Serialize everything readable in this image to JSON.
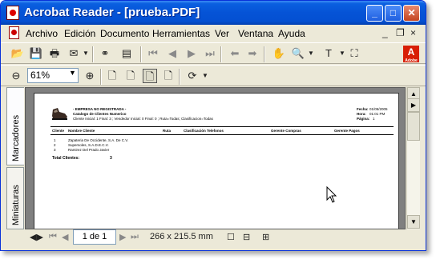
{
  "window": {
    "title": "Acrobat Reader - [prueba.PDF]",
    "controls": {
      "minimize": "_",
      "maximize": "□",
      "close": "✕"
    }
  },
  "menubar": {
    "items": [
      "Archivo",
      "Edición",
      "Documento",
      "Herramientas",
      "Ver",
      "Ventana",
      "Ayuda"
    ],
    "mdi": {
      "minimize": "_",
      "restore": "❐",
      "close": "×"
    }
  },
  "toolbar2": {
    "zoom_value": "61%"
  },
  "sidebar": {
    "tabs": [
      "Marcadores",
      "Miniaturas"
    ]
  },
  "document": {
    "company": "- EMPRESA NO REGISTRADA -",
    "report_title": "Catalogo de Clientes Numerico",
    "filters": "Cliente Inicial: 1 Final: 3 ;   Vendedor Inicial: 0 Final: 0 ;   Ruta=Todas;   Clasificacion=Todas",
    "date_label": "Fecha:",
    "date_value": "01/05/2005",
    "time_label": "Hora:",
    "time_value": "01:01 PM",
    "page_label": "Página:",
    "page_value": "1",
    "columns": [
      "Cliente",
      "Nombre Cliente",
      "Ruta",
      "Clasificación",
      "Telefonos",
      "Gerente Compras",
      "Gerente Pagos"
    ],
    "rows": [
      {
        "id": "1",
        "name": "Zapateria De Occidente, S.A. De C.V."
      },
      {
        "id": "2",
        "name": "Supersoles, S.A.D.E.C.V."
      },
      {
        "id": "3",
        "name": "Ramirez Del Prado Javier"
      }
    ],
    "total_label": "Total Clientes:",
    "total_value": "3"
  },
  "statusbar": {
    "page_display": "1 de 1",
    "dimensions": "266 x 215.5  mm"
  }
}
